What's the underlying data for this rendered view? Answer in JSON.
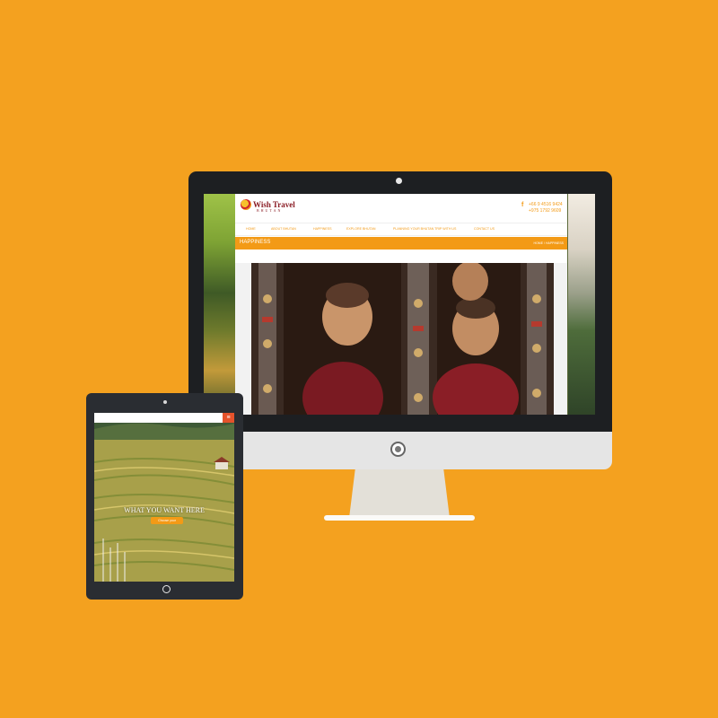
{
  "colors": {
    "background": "#f4a11f",
    "accent": "#f39a16",
    "device_dark": "#1d1f22",
    "cta_red": "#e5522b"
  },
  "desktop": {
    "site": {
      "logo": {
        "title": "Wish Travel",
        "subtitle": "BHUTAN"
      },
      "contact": {
        "icon": "facebook-icon",
        "phone_1": "+66 9 4516 9424",
        "phone_2": "+975 1792 9609"
      },
      "nav": [
        "HOME",
        "ABOUT BHUTAN",
        "HAPPINESS",
        "EXPLORE BHUTAN",
        "PLANNING YOUR BHUTAN TRIP WITH US",
        "CONTACT US"
      ],
      "page_title": "HAPPINESS",
      "breadcrumb": "HOME / HAPPINESS"
    }
  },
  "tablet": {
    "hero_text": "WHAT YOU WANT HERE",
    "cta_label": "Choose your",
    "menu_icon": "menu-icon"
  }
}
